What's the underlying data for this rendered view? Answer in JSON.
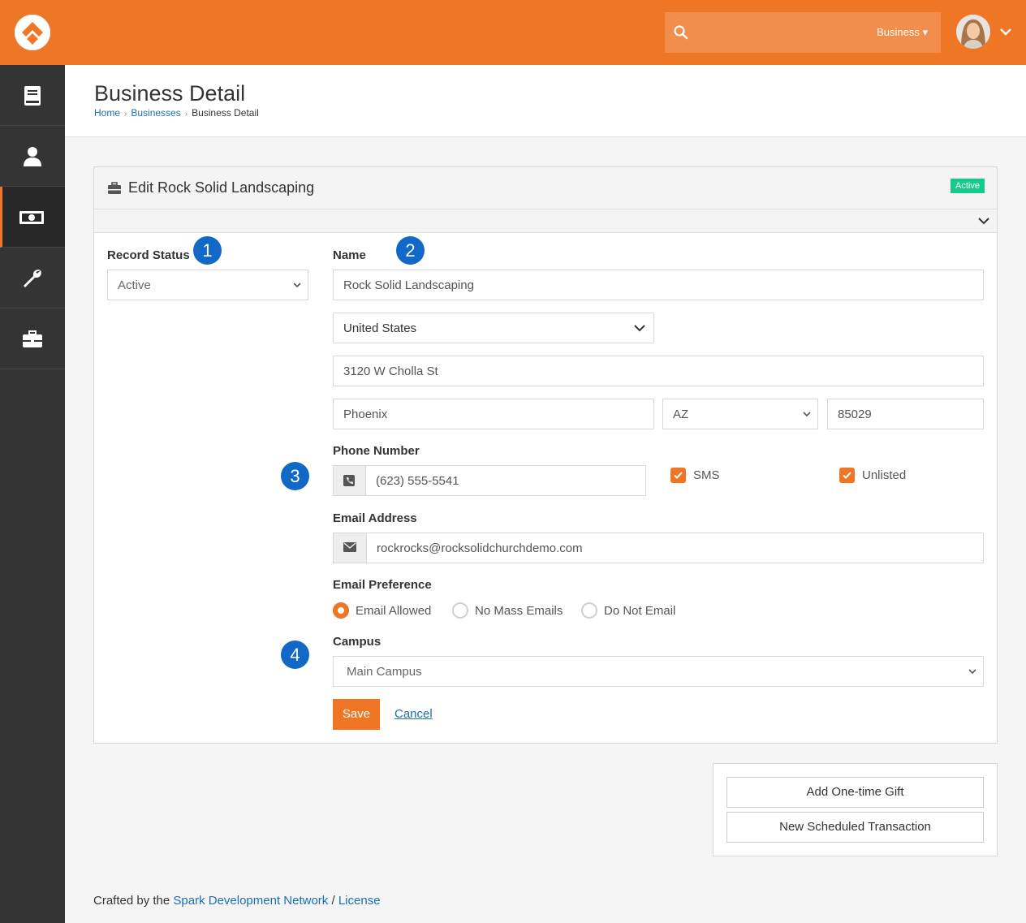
{
  "header": {
    "search_placeholder": "",
    "search_scope": "Business ▾"
  },
  "page": {
    "title": "Business Detail",
    "breadcrumb": [
      "Home",
      "Businesses",
      "Business Detail"
    ]
  },
  "panel": {
    "title": "Edit Rock Solid Landscaping",
    "status_label": "Active"
  },
  "form": {
    "record_status_label": "Record Status",
    "record_status_value": "Active",
    "name_label": "Name",
    "name_value": "Rock Solid Landscaping",
    "country_value": "United States",
    "street_value": "3120 W Cholla St",
    "city_value": "Phoenix",
    "state_value": "AZ",
    "zip_value": "85029",
    "phone_label": "Phone Number",
    "phone_value": "(623) 555-5541",
    "sms_label": "SMS",
    "unlisted_label": "Unlisted",
    "email_label": "Email Address",
    "email_value": "rockrocks@rocksolidchurchdemo.com",
    "email_pref_label": "Email Preference",
    "email_pref_options": [
      "Email Allowed",
      "No Mass Emails",
      "Do Not Email"
    ],
    "email_pref_selected": "Email Allowed",
    "campus_label": "Campus",
    "campus_value": "Main Campus",
    "save_label": "Save",
    "cancel_label": "Cancel"
  },
  "callouts": [
    "1",
    "2",
    "3",
    "4"
  ],
  "gift": {
    "add_gift_label": "Add One-time Gift",
    "scheduled_label": "New Scheduled Transaction"
  },
  "footer": {
    "prefix": "Crafted by the ",
    "link1": "Spark Development Network",
    "sep": " / ",
    "link2": "License"
  },
  "sidebar": {
    "icons": [
      "book-icon",
      "person-icon",
      "money-icon",
      "wrench-icon",
      "briefcase-icon"
    ],
    "active": "money-icon"
  },
  "colors": {
    "brand": "#ee7624",
    "sidebar": "#343434",
    "callout": "#1268c6",
    "active_badge": "#16c98d",
    "link": "#1b6fb3"
  }
}
